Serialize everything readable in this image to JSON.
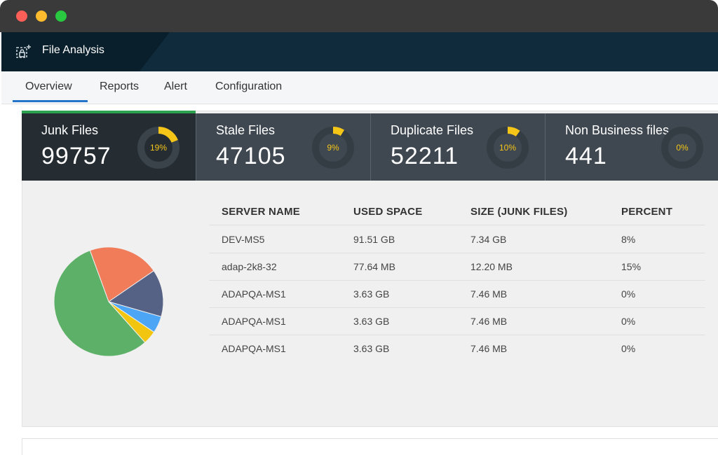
{
  "window": {
    "traffic_lights": [
      "close",
      "minimize",
      "maximize"
    ]
  },
  "app": {
    "title": "File Analysis",
    "icon": "lock-add-icon"
  },
  "tabs": [
    {
      "label": "Overview",
      "active": true
    },
    {
      "label": "Reports",
      "active": false
    },
    {
      "label": "Alert",
      "active": false
    },
    {
      "label": "Configuration",
      "active": false
    }
  ],
  "cards": [
    {
      "label": "Junk Files",
      "value": "99757",
      "percent_label": "19%",
      "percent": 19
    },
    {
      "label": "Stale Files",
      "value": "47105",
      "percent_label": "9%",
      "percent": 9
    },
    {
      "label": "Duplicate Files",
      "value": "52211",
      "percent_label": "10%",
      "percent": 10
    },
    {
      "label": "Non Business files",
      "value": "441",
      "percent_label": "0%",
      "percent": 0
    }
  ],
  "colors": {
    "accent_ring": "#f5c518",
    "active_tab_underline": "#2474c9",
    "selected_card_bar": "#2ca24f",
    "header_bg": "#0f2b3c"
  },
  "table": {
    "headers": [
      "SERVER NAME",
      "USED SPACE",
      "SIZE (JUNK FILES)",
      "PERCENT"
    ],
    "rows": [
      [
        "DEV-MS5",
        "91.51 GB",
        "7.34 GB",
        "8%"
      ],
      [
        "adap-2k8-32",
        "77.64 MB",
        "12.20 MB",
        "15%"
      ],
      [
        "ADAPQA-MS1",
        "3.63 GB",
        "7.46 MB",
        "0%"
      ],
      [
        "ADAPQA-MS1",
        "3.63 GB",
        "7.46 MB",
        "0%"
      ],
      [
        "ADAPQA-MS1",
        "3.63 GB",
        "7.46 MB",
        "0%"
      ]
    ]
  },
  "chart_data": {
    "type": "pie",
    "slices": [
      {
        "value": 21,
        "color": "#f07c5a"
      },
      {
        "value": 14,
        "color": "#556185"
      },
      {
        "value": 5,
        "color": "#4da6f5"
      },
      {
        "value": 4,
        "color": "#f2c511"
      },
      {
        "value": 56,
        "color": "#5db067"
      }
    ]
  }
}
